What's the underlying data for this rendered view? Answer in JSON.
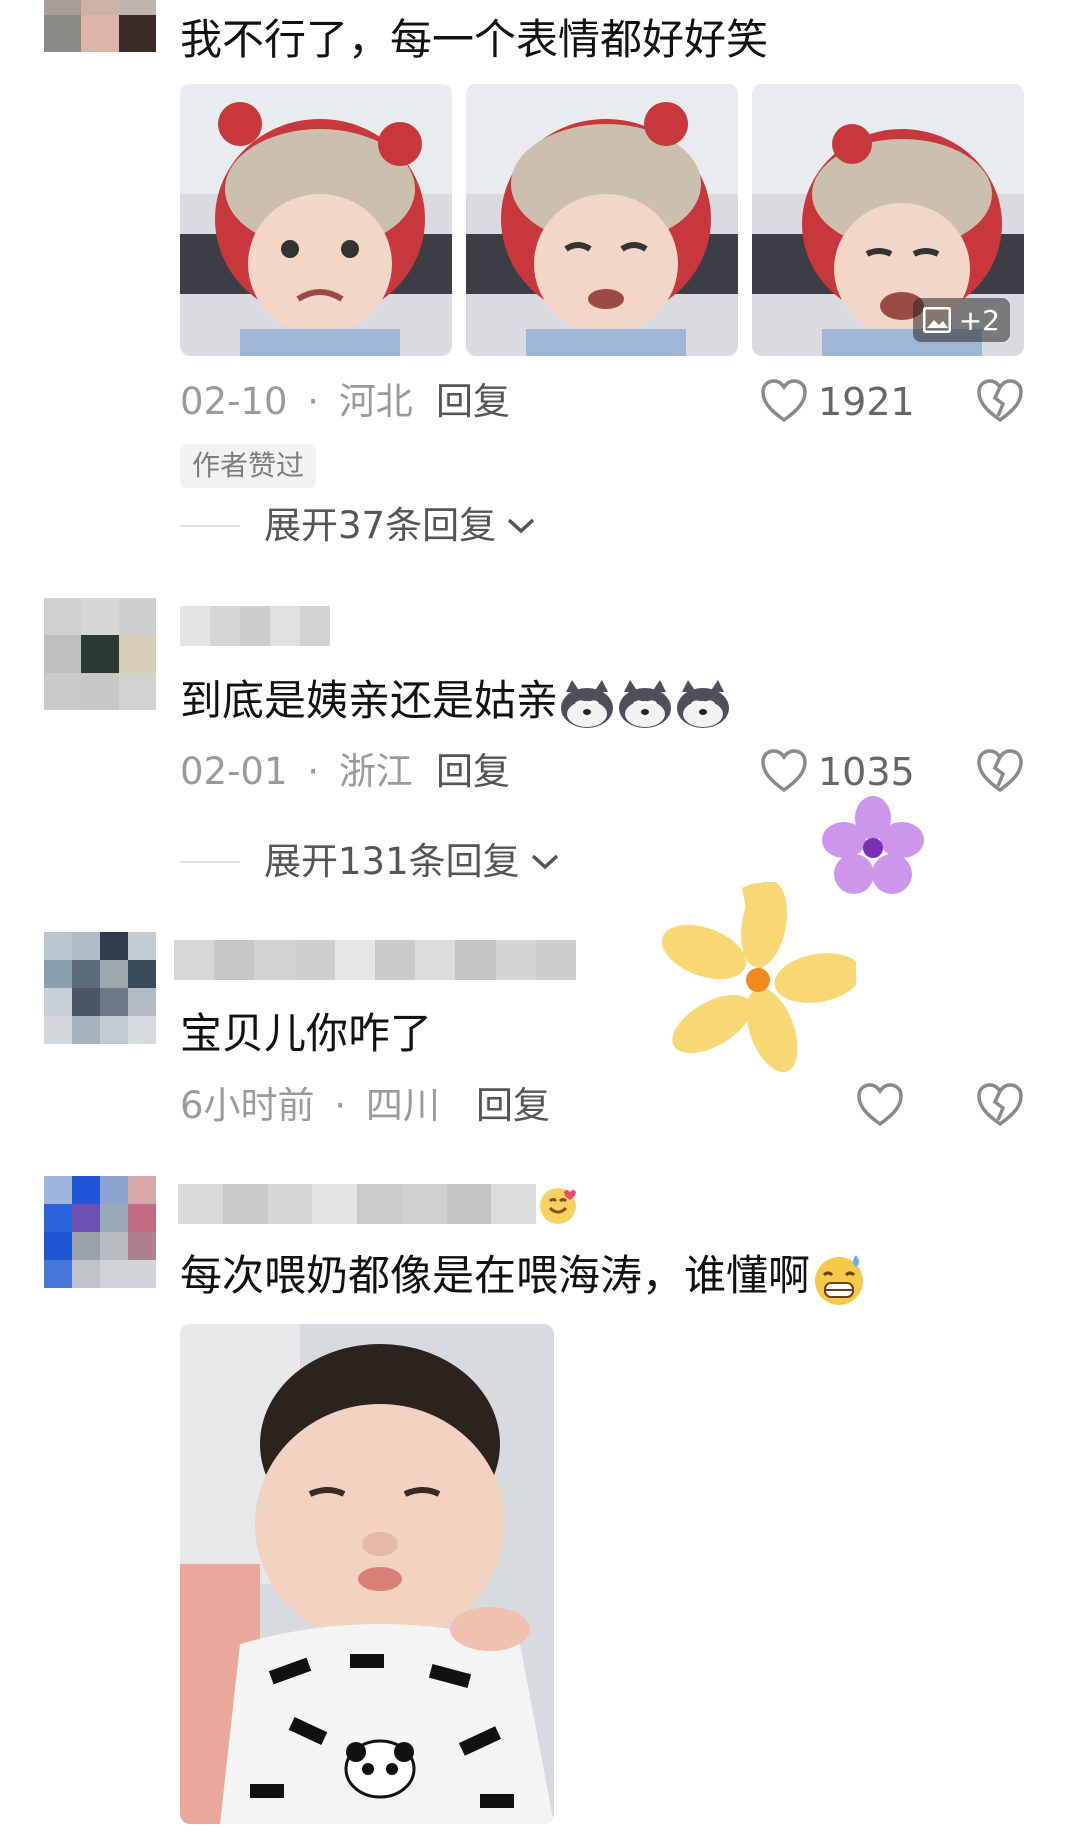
{
  "comments": [
    {
      "text": "我不行了，每一个表情都好好笑",
      "date": "02-10",
      "separator": "·",
      "location": "河北",
      "reply_label": "回复",
      "likes": "1921",
      "author_badge": "作者赞过",
      "expand_label": "展开37条回复",
      "image_more": "+2"
    },
    {
      "text": "到底是姨亲还是姑亲",
      "date": "02-01",
      "separator": "·",
      "location": "浙江",
      "reply_label": "回复",
      "likes": "1035",
      "expand_label": "展开131条回复"
    },
    {
      "text": "宝贝儿你咋了",
      "date": "6小时前",
      "separator": "·",
      "location": "四川",
      "reply_label": "回复",
      "likes": ""
    },
    {
      "text": "每次喂奶都像是在喂海涛，谁懂啊"
    }
  ],
  "icons": {
    "like": "heart-outline-icon",
    "dislike": "broken-heart-icon",
    "expand": "chevron-down-icon",
    "gallery": "image-icon"
  },
  "colors": {
    "text": "#111111",
    "meta": "#9a9a9a",
    "hat_red": "#c8373c",
    "flower_purple": "#c98be8",
    "flower_yellow": "#f7d56a"
  }
}
